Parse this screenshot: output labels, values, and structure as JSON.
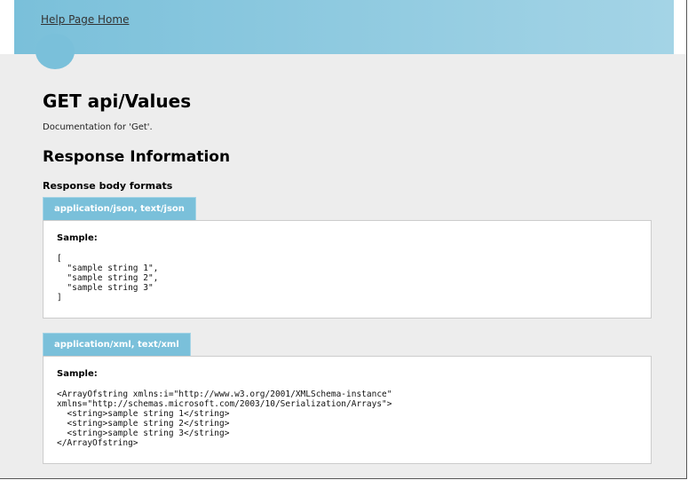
{
  "header": {
    "home_link": "Help Page Home"
  },
  "page": {
    "title": "GET api/Values",
    "documentation": "Documentation for 'Get'.",
    "response_section_title": "Response Information",
    "body_formats_title": "Response body formats"
  },
  "formats": [
    {
      "tab_label": "application/json, text/json",
      "sample_label": "Sample:",
      "sample_code": "[\n  \"sample string 1\",\n  \"sample string 2\",\n  \"sample string 3\"\n]"
    },
    {
      "tab_label": "application/xml, text/xml",
      "sample_label": "Sample:",
      "sample_code": "<ArrayOfstring xmlns:i=\"http://www.w3.org/2001/XMLSchema-instance\"\nxmlns=\"http://schemas.microsoft.com/2003/10/Serialization/Arrays\">\n  <string>sample string 1</string>\n  <string>sample string 2</string>\n  <string>sample string 3</string>\n</ArrayOfstring>"
    }
  ],
  "colors": {
    "header_start": "#7ac0da",
    "header_end": "#a4d4e6",
    "tab": "#7ac0da",
    "background": "#ededed"
  }
}
